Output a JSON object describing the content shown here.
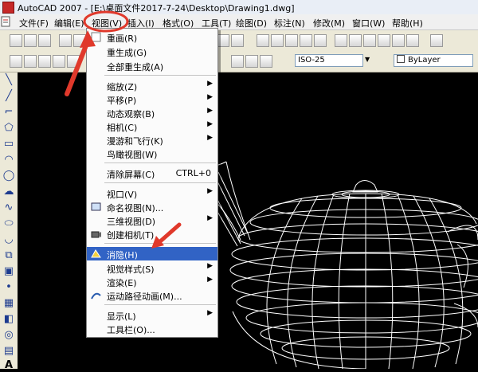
{
  "window": {
    "title": "AutoCAD 2007 - [E:\\桌面文件2017-7-24\\Desktop\\Drawing1.dwg]"
  },
  "menubar": {
    "items": [
      {
        "label": "文件(F)"
      },
      {
        "label": "编辑(E)"
      },
      {
        "label": "视图(V)"
      },
      {
        "label": "插入(I)"
      },
      {
        "label": "格式(O)"
      },
      {
        "label": "工具(T)"
      },
      {
        "label": "绘图(D)"
      },
      {
        "label": "标注(N)"
      },
      {
        "label": "修改(M)"
      },
      {
        "label": "窗口(W)"
      },
      {
        "label": "帮助(H)"
      }
    ]
  },
  "toolbar": {
    "textstyle_value": "ISO-25",
    "layer_value": "ByLayer"
  },
  "view_menu": {
    "items": [
      {
        "label": "重画(R)"
      },
      {
        "label": "重生成(G)"
      },
      {
        "label": "全部重生成(A)"
      },
      {
        "label": "缩放(Z)"
      },
      {
        "label": "平移(P)"
      },
      {
        "label": "动态观察(B)"
      },
      {
        "label": "相机(C)"
      },
      {
        "label": "漫游和飞行(K)"
      },
      {
        "label": "鸟瞰视图(W)"
      },
      {
        "label": "清除屏幕(C)",
        "shortcut": "CTRL+0"
      },
      {
        "label": "视口(V)"
      },
      {
        "label": "命名视图(N)..."
      },
      {
        "label": "三维视图(D)"
      },
      {
        "label": "创建相机(T)"
      },
      {
        "label": "消隐(H)"
      },
      {
        "label": "视觉样式(S)"
      },
      {
        "label": "渲染(E)"
      },
      {
        "label": "运动路径动画(M)..."
      },
      {
        "label": "显示(L)"
      },
      {
        "label": "工具栏(O)..."
      }
    ]
  },
  "colors": {
    "highlight": "#3163c5",
    "annotation": "#e0392b",
    "canvas": "#000000"
  }
}
